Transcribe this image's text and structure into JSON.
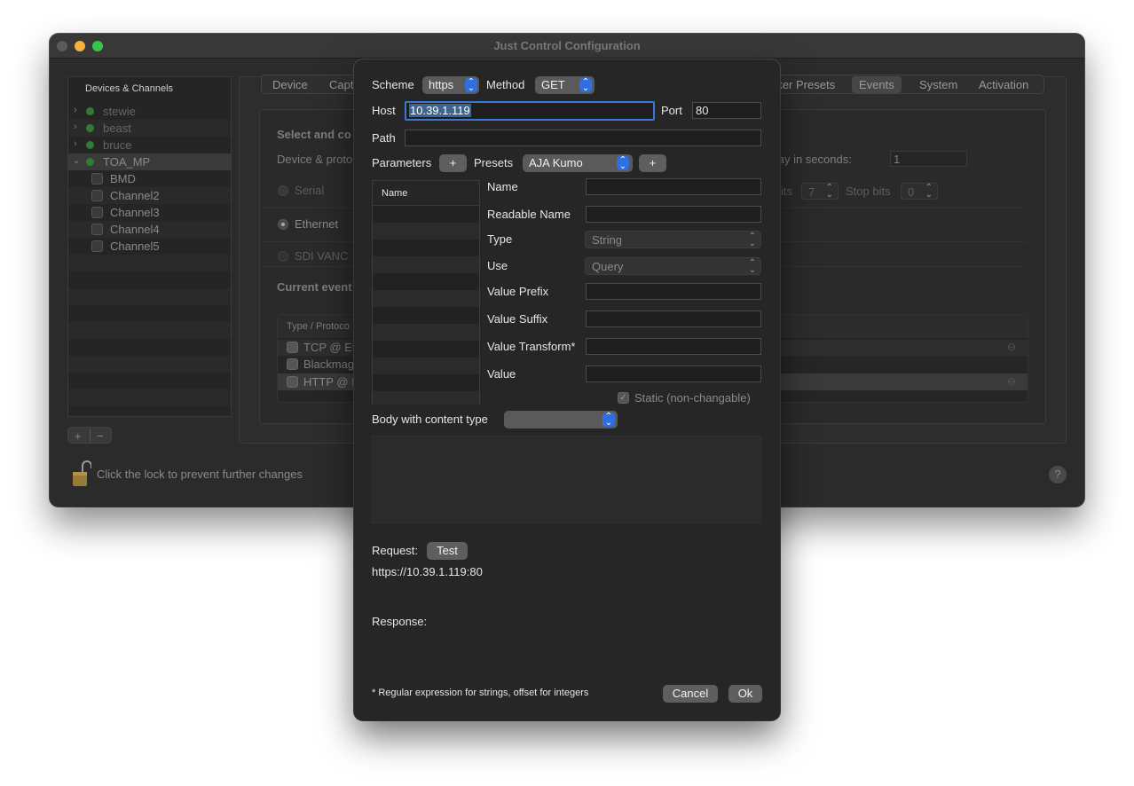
{
  "window": {
    "title": "Just Control Configuration"
  },
  "sidebar": {
    "header": "Devices & Channels",
    "devices": [
      {
        "label": "stewie",
        "dimmed": true
      },
      {
        "label": "beast",
        "dimmed": true
      },
      {
        "label": "bruce",
        "dimmed": true
      },
      {
        "label": "TOA_MP",
        "dimmed": false
      }
    ],
    "channels": [
      "BMD",
      "Channel2",
      "Channel3",
      "Channel4",
      "Channel5"
    ],
    "add_label": "+",
    "remove_label": "−"
  },
  "tabs": {
    "left": [
      "Device",
      "Capt"
    ],
    "right": [
      "rker Presets",
      "Events",
      "System",
      "Activation"
    ],
    "selected": "Events"
  },
  "main": {
    "select_heading": "Select and co",
    "device_protocol": "Device & proto",
    "serial": "Serial",
    "ethernet": "Ethernet",
    "sdi": "SDI VANC",
    "current_events": "Current event",
    "delay_label": "t/Delay in seconds:",
    "delay_value": "1",
    "bits_label": "its",
    "bits_value": "7",
    "stop_bits_label": "Stop bits",
    "stop_bits_value": "0",
    "table_header": "Type / Protoco",
    "events": [
      "TCP @ Et",
      "Blackmag",
      "HTTP @ I"
    ]
  },
  "lock_text": "Click the lock to prevent further changes",
  "help_label": "?",
  "dialog": {
    "scheme_label": "Scheme",
    "scheme_value": "https",
    "method_label": "Method",
    "method_value": "GET",
    "host_label": "Host",
    "host_value": "10.39.1.119",
    "port_label": "Port",
    "port_value": "80",
    "path_label": "Path",
    "path_value": "",
    "parameters_label": "Parameters",
    "add_param": "+",
    "presets_label": "Presets",
    "presets_value": "AJA Kumo",
    "add_preset": "+",
    "param_table_header": "Name",
    "fields": {
      "name": "Name",
      "readable_name": "Readable Name",
      "type": "Type",
      "type_value": "String",
      "use": "Use",
      "use_value": "Query",
      "value_prefix": "Value Prefix",
      "value_suffix": "Value Suffix",
      "value_transform": "Value Transform*",
      "value": "Value",
      "static": "Static (non-changable)"
    },
    "body_label": "Body with content type",
    "body_value": "",
    "request_label": "Request:",
    "test_button": "Test",
    "request_url": "https://10.39.1.119:80",
    "response_label": "Response:",
    "footnote": "* Regular expression for strings, offset for integers",
    "cancel_button": "Cancel",
    "ok_button": "Ok"
  },
  "colors": {
    "accent": "#2f6fe0",
    "status_green": "#2e7d32"
  }
}
